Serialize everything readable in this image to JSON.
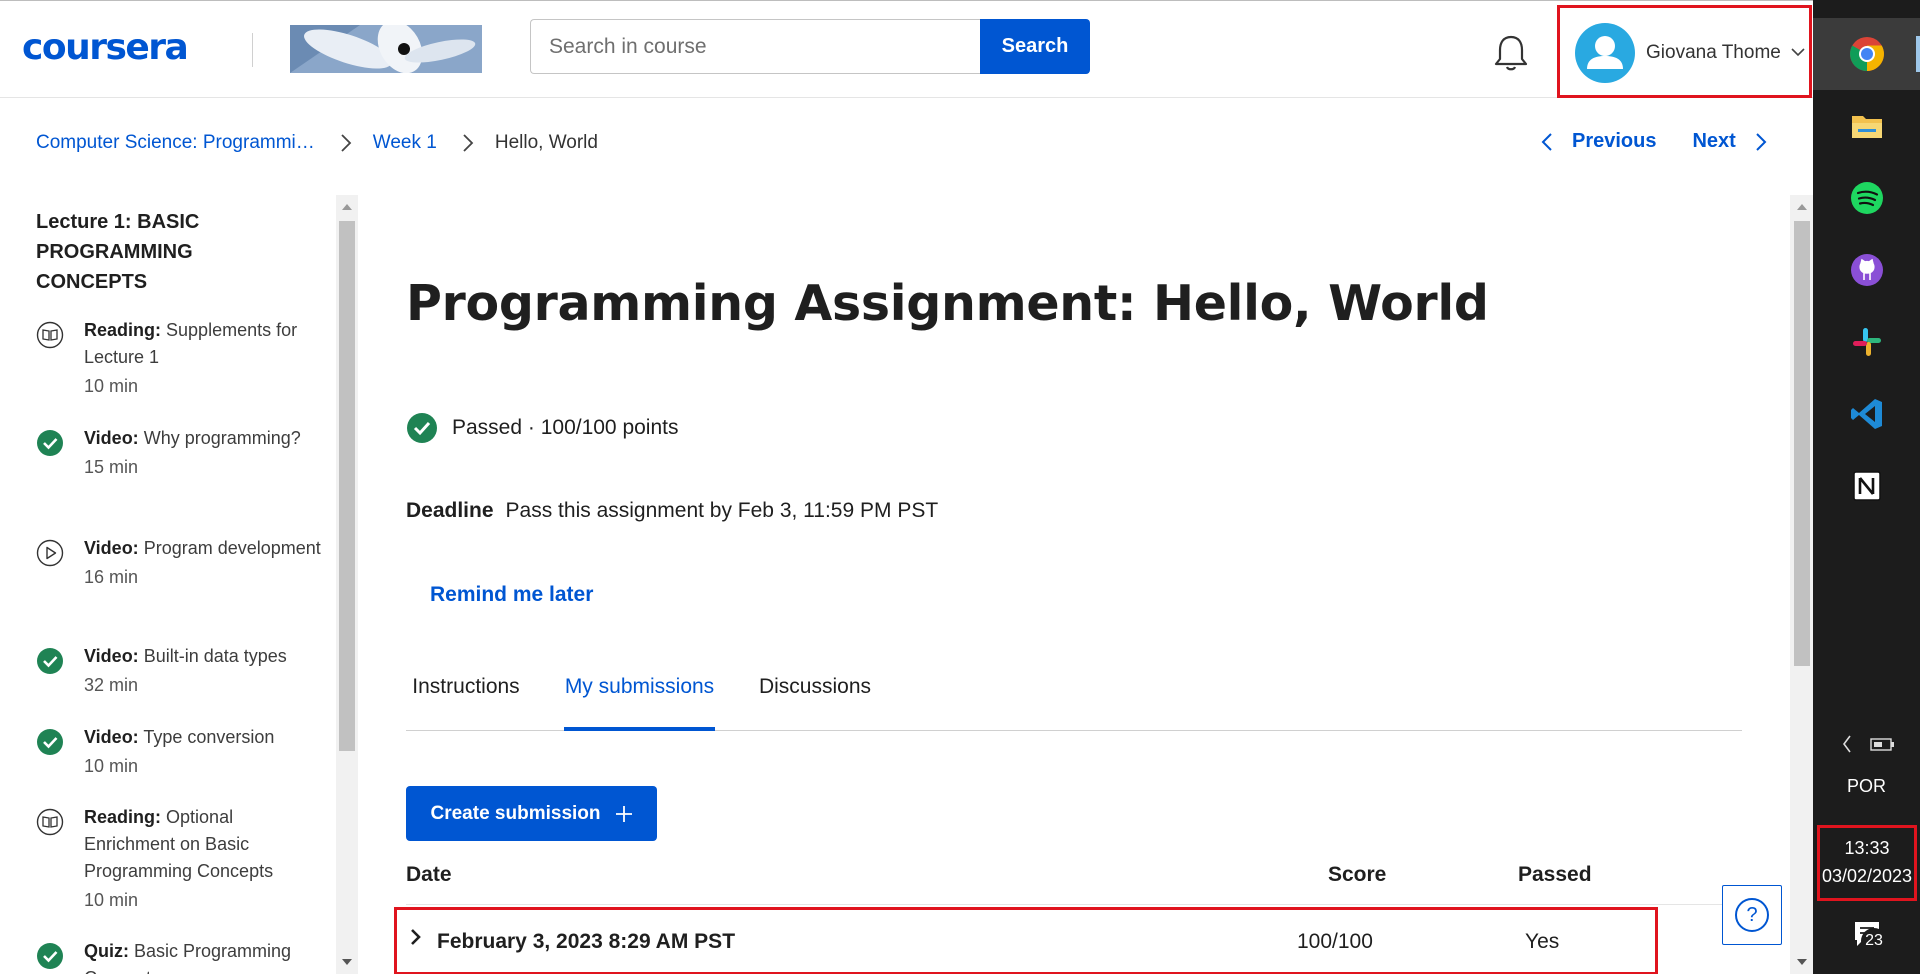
{
  "header": {
    "logo_text": "coursera",
    "search": {
      "placeholder": "Search in course",
      "button_label": "Search"
    },
    "user": {
      "name": "Giovana Thome"
    }
  },
  "breadcrumb": {
    "items": [
      "Computer Science: Programmi…",
      "Week 1"
    ],
    "current": "Hello, World"
  },
  "pager": {
    "previous_label": "Previous",
    "next_label": "Next"
  },
  "sidebar": {
    "title": "Lecture 1: BASIC PROGRAMMING CONCEPTS",
    "items": [
      {
        "type": "Reading:",
        "name": "Supplements for Lecture 1",
        "duration": "10 min",
        "icon": "reading-icon"
      },
      {
        "type": "Video:",
        "name": "Why programming?",
        "duration": "15 min",
        "icon": "completed-check-icon"
      },
      {
        "type": "Video:",
        "name": "Program development",
        "duration": "16 min",
        "icon": "play-icon"
      },
      {
        "type": "Video:",
        "name": "Built-in data types",
        "duration": "32 min",
        "icon": "completed-check-icon"
      },
      {
        "type": "Video:",
        "name": "Type conversion",
        "duration": "10 min",
        "icon": "completed-check-icon"
      },
      {
        "type": "Reading:",
        "name": "Optional Enrichment on Basic Programming Concepts",
        "duration": "10 min",
        "icon": "reading-icon"
      },
      {
        "type": "Quiz:",
        "name": "Basic Programming Concepts",
        "duration": "",
        "icon": "completed-check-icon"
      }
    ]
  },
  "main": {
    "title": "Programming Assignment: Hello, World",
    "status": "Passed · 100/100 points",
    "deadline_label": "Deadline",
    "deadline_text": "Pass this assignment by Feb 3, 11:59 PM PST",
    "remind_label": "Remind me later",
    "tabs": [
      "Instructions",
      "My submissions",
      "Discussions"
    ],
    "active_tab": "My submissions",
    "create_button_label": "Create submission",
    "table": {
      "headers": {
        "date": "Date",
        "score": "Score",
        "passed": "Passed"
      },
      "rows": [
        {
          "date": "February 3, 2023 8:29 AM PST",
          "score": "100/100",
          "passed": "Yes"
        }
      ]
    },
    "help_label": "?"
  },
  "taskbar": {
    "apps": [
      "chrome-icon",
      "file-explorer-icon",
      "spotify-icon",
      "github-icon",
      "slack-icon",
      "vscode-icon",
      "notion-icon"
    ],
    "language": "POR",
    "time": "13:33",
    "date": "03/02/2023",
    "notification_count": "23"
  },
  "colors": {
    "accent": "#0056d2",
    "success": "#1f8354",
    "highlight": "#e0141e",
    "taskbar": "#1c1c1c"
  }
}
